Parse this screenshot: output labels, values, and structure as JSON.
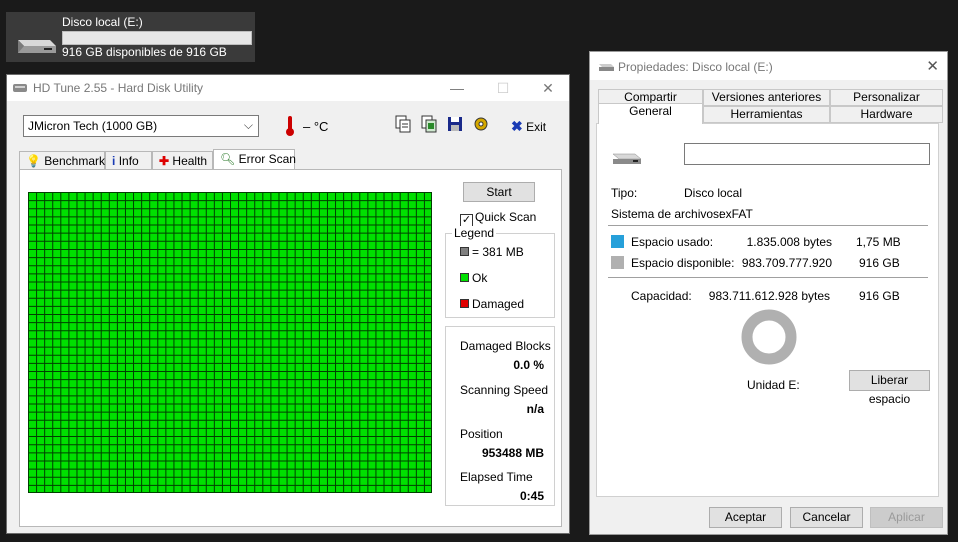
{
  "drive_tile": {
    "name": "Disco local (E:)",
    "free_text": "916 GB disponibles de 916 GB",
    "used_fraction": 0.0
  },
  "hdtune": {
    "title": "HD Tune 2.55 - Hard Disk Utility",
    "drive_selected": "JMicron Tech (1000 GB)",
    "temperature": "– °C",
    "toolbar": {
      "exit_label": "Exit"
    },
    "tabs": [
      "Benchmark",
      "Info",
      "Health",
      "Error Scan"
    ],
    "active_tab": "Error Scan",
    "error_scan": {
      "start_label": "Start",
      "quick_scan_label": "Quick Scan",
      "quick_scan_checked": true,
      "legend_title": "Legend",
      "legend": [
        {
          "label": "= 381 MB",
          "color": "#808080"
        },
        {
          "label": "Ok",
          "color": "#00e000"
        },
        {
          "label": "Damaged",
          "color": "#e00000"
        }
      ],
      "grid_block_color": "#00e000",
      "grid_line_color": "#004000",
      "damaged_blocks_label": "Damaged Blocks",
      "damaged_blocks_value": "0.0 %",
      "scanning_speed_label": "Scanning Speed",
      "scanning_speed_value": "n/a",
      "position_label": "Position",
      "position_value": "953488 MB",
      "elapsed_label": "Elapsed Time",
      "elapsed_value": "0:45"
    }
  },
  "properties": {
    "title": "Propiedades: Disco local (E:)",
    "tabs_back": [
      "Compartir",
      "Versiones anteriores",
      "Personalizar"
    ],
    "tabs_front": [
      "General",
      "Herramientas",
      "Hardware"
    ],
    "active_tab": "General",
    "name_value": "",
    "tipo_label": "Tipo:",
    "tipo_value": "Disco local",
    "fs_label": "Sistema de archivos:",
    "fs_value": "exFAT",
    "used": {
      "label": "Espacio usado:",
      "bytes": "1.835.008 bytes",
      "size": "1,75 MB",
      "color": "#26a0da"
    },
    "free": {
      "label": "Espacio disponible:",
      "bytes": "983.709.777.920",
      "size": "916 GB",
      "color": "#b0b0b0"
    },
    "capacity": {
      "label": "Capacidad:",
      "bytes": "983.711.612.928 bytes",
      "size": "916 GB"
    },
    "unit_label": "Unidad E:",
    "free_space_button": "Liberar espacio",
    "buttons": {
      "ok": "Aceptar",
      "cancel": "Cancelar",
      "apply": "Aplicar"
    }
  }
}
